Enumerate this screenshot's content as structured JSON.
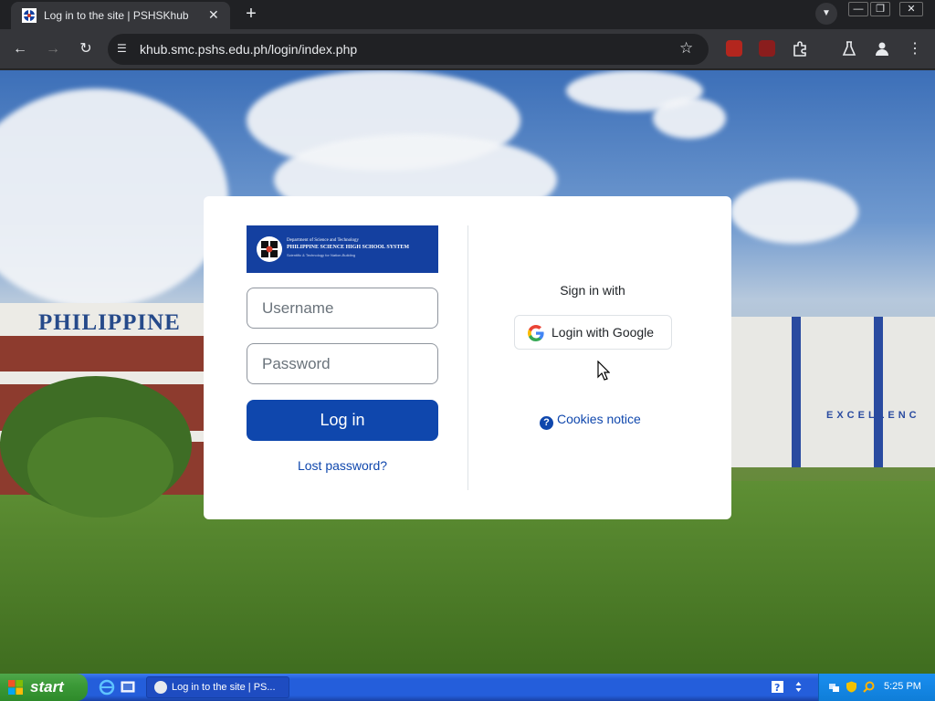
{
  "browser": {
    "tab_title": "Log in to the site | PSHSKhub",
    "url": "khub.smc.pshs.edu.ph/login/index.php",
    "new_tab_label": "+",
    "close_tab_label": "✕"
  },
  "logo": {
    "line1": "Department of Science and Technology",
    "line2": "PHILIPPINE SCIENCE HIGH SCHOOL SYSTEM",
    "line3": "Scientific & Technology for Nation-Building"
  },
  "background": {
    "left_building_sign": "PHILIPPINE",
    "right_building_sign": "EXCELLENC"
  },
  "login": {
    "username_placeholder": "Username",
    "username_value": "",
    "password_placeholder": "Password",
    "password_value": "",
    "login_button": "Log in",
    "lost_password": "Lost password?",
    "sign_in_with": "Sign in with",
    "google_button": "Login with Google",
    "cookies_notice": "Cookies notice"
  },
  "taskbar": {
    "start_label": "start",
    "task_item_label": "Log in to the site | PS...",
    "clock": "5:25 PM"
  },
  "colors": {
    "primary": "#0f47ad",
    "logo_bg": "#1440a0",
    "taskbar": "#245edb",
    "start": "#3c9a38"
  }
}
